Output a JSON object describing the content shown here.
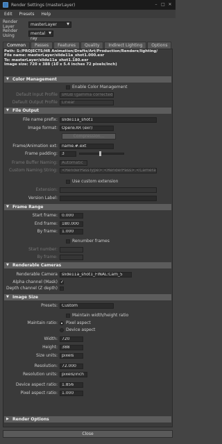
{
  "window": {
    "title": "Render Settings (masterLayer)"
  },
  "menu": [
    "Edit",
    "Presets",
    "Help"
  ],
  "render_layer": {
    "label": "Render Layer",
    "value": "masterLayer"
  },
  "render_using": {
    "label": "Render Using",
    "value": "mental ray"
  },
  "tabs": [
    "Common",
    "Passes",
    "Features",
    "Quality",
    "Indirect Lighting",
    "Options"
  ],
  "path_info": {
    "path": "Path: S:/PROJECTS/HR Animation/Drafts/Art/Production/Renders/lighting/",
    "file": "File name:  masterLayer/slide11a_shot1.000.exr",
    "to": "To:           masterLayer/slide11a_shot1.180.exr",
    "size": "Image size:  720 x 388 (10 x 5.4 inches 72 pixels/inch)"
  },
  "color_management": {
    "title": "Color Management",
    "enable_label": "Enable Color Management",
    "input_label": "Default Input Profile",
    "input_value": "sRGB (gamma corrected)",
    "output_label": "Default Output Profile",
    "output_value": "Linear"
  },
  "file_output": {
    "title": "File Output",
    "prefix_label": "File name prefix:",
    "prefix_value": "slide11a_shot1",
    "format_label": "Image format:",
    "format_value": "OpenEXR (exr)",
    "compression_label": "Compression...",
    "frame_ext_label": "Frame/Animation ext:",
    "frame_ext_value": "name.#.ext",
    "padding_label": "Frame padding:",
    "padding_value": "3",
    "buffer_label": "Frame Buffer Naming:",
    "buffer_value": "Automatic",
    "custom_naming_label": "Custom Naming String:",
    "custom_naming_value": "<RenderPassType>:<RenderPass>.<Camera>",
    "use_custom_ext_label": "Use custom extension",
    "extension_label": "Extension:",
    "extension_value": "",
    "version_label": "Version Label:",
    "version_value": ""
  },
  "frame_range": {
    "title": "Frame Range",
    "start_label": "Start frame:",
    "start_value": "0.000",
    "end_label": "End frame:",
    "end_value": "180.000",
    "by_label": "By frame:",
    "by_value": "1.000",
    "renumber_label": "Renumber frames",
    "start_number_label": "Start number:",
    "start_number_value": "",
    "by_number_label": "By frame:",
    "by_number_value": ""
  },
  "renderable_cameras": {
    "title": "Renderable Cameras",
    "camera_label": "Renderable Camera",
    "camera_value": "slide11a_shot1_FINAL:Cam_5",
    "alpha_label": "Alpha channel (Mask)",
    "depth_label": "Depth channel (Z depth)"
  },
  "image_size": {
    "title": "Image Size",
    "presets_label": "Presets:",
    "presets_value": "Custom",
    "maintain_wh_label": "Maintain width/height ratio",
    "maintain_ratio_label": "Maintain ratio:",
    "pixel_aspect_option": "Pixel aspect",
    "device_aspect_option": "Device aspect",
    "width_label": "Width:",
    "width_value": "720",
    "height_label": "Height:",
    "height_value": "388",
    "size_units_label": "Size units:",
    "size_units_value": "pixels",
    "resolution_label": "Resolution:",
    "resolution_value": "72.000",
    "resolution_units_label": "Resolution units:",
    "resolution_units_value": "pixels/inch",
    "device_aspect_label": "Device aspect ratio:",
    "device_aspect_value": "1.856",
    "pixel_aspect_label": "Pixel aspect ratio:",
    "pixel_aspect_value": "1.000"
  },
  "render_options": {
    "title": "Render Options"
  },
  "close_label": "Close"
}
